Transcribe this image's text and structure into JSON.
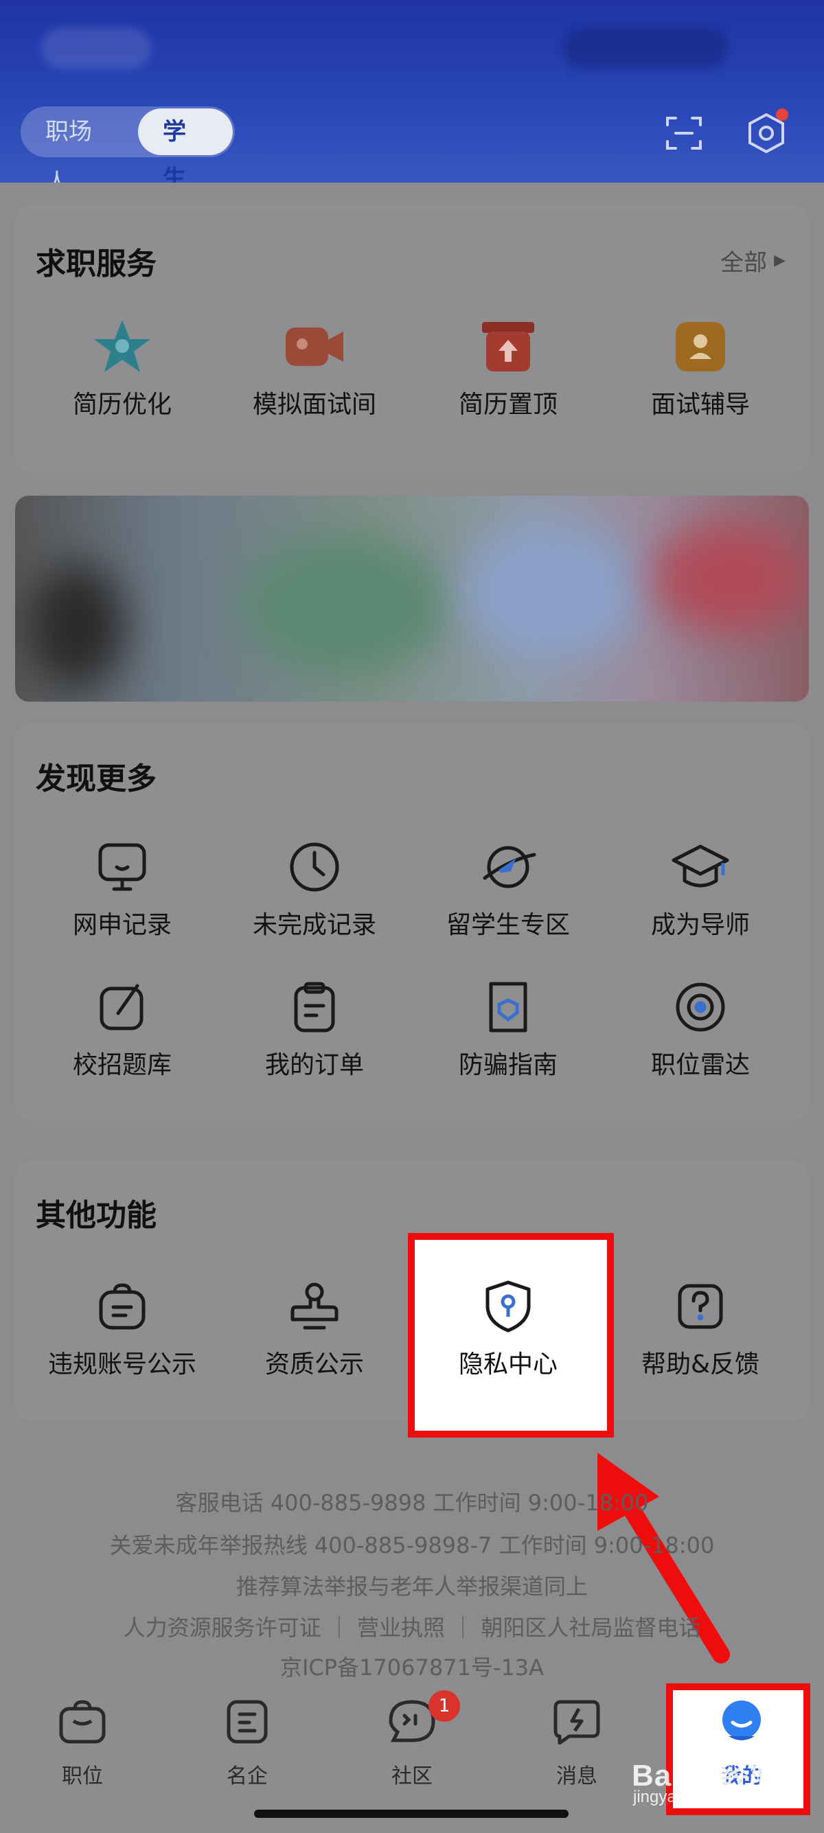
{
  "header": {
    "roles": [
      "职场人",
      "学生"
    ],
    "active_role": "学生",
    "scan_icon": "scan-icon",
    "settings_icon": "settings-icon"
  },
  "job_services": {
    "title": "求职服务",
    "see_all": "全部",
    "items": [
      {
        "label": "简历优化",
        "icon": "star-resume-icon"
      },
      {
        "label": "模拟面试间",
        "icon": "video-camera-icon"
      },
      {
        "label": "简历置顶",
        "icon": "top-box-icon"
      },
      {
        "label": "面试辅导",
        "icon": "coach-icon"
      }
    ]
  },
  "discover_more": {
    "title": "发现更多",
    "items": [
      {
        "label": "网申记录",
        "icon": "monitor-icon"
      },
      {
        "label": "未完成记录",
        "icon": "clock-icon"
      },
      {
        "label": "留学生专区",
        "icon": "globe-plane-icon"
      },
      {
        "label": "成为导师",
        "icon": "graduation-cap-icon"
      },
      {
        "label": "校招题库",
        "icon": "edit-icon"
      },
      {
        "label": "我的订单",
        "icon": "clipboard-icon"
      },
      {
        "label": "防骗指南",
        "icon": "shield-book-icon"
      },
      {
        "label": "职位雷达",
        "icon": "radar-icon"
      }
    ]
  },
  "other_functions": {
    "title": "其他功能",
    "items": [
      {
        "label": "违规账号公示",
        "icon": "bag-notice-icon"
      },
      {
        "label": "资质公示",
        "icon": "stamp-icon"
      },
      {
        "label": "隐私中心",
        "icon": "privacy-shield-icon"
      },
      {
        "label": "帮助&反馈",
        "icon": "help-icon"
      }
    ]
  },
  "footer": {
    "line1": "客服电话 400-885-9898  工作时间 9:00-18:00",
    "line2": "关爱未成年举报热线 400-885-9898-7  工作时间 9:00-18:00",
    "line3": "推荐算法举报与老年人举报渠道同上",
    "line4": "人力资源服务许可证 ｜ 营业执照 ｜ 朝阳区人社局监督电话",
    "line5": "京ICP备17067871号-13A"
  },
  "tabbar": {
    "tabs": [
      {
        "label": "职位",
        "icon": "briefcase-icon"
      },
      {
        "label": "名企",
        "icon": "company-icon"
      },
      {
        "label": "社区",
        "icon": "community-icon"
      },
      {
        "label": "消息",
        "icon": "message-icon"
      },
      {
        "label": "我的",
        "icon": "profile-icon"
      }
    ],
    "community_badge": "1"
  },
  "watermark": {
    "text": "Baidu经验",
    "sub": "jingyan.baidu.com"
  },
  "colors": {
    "header_blue": "#2a48b8",
    "highlight_red": "#ee0d0d",
    "accent_blue": "#2f7ff0"
  }
}
